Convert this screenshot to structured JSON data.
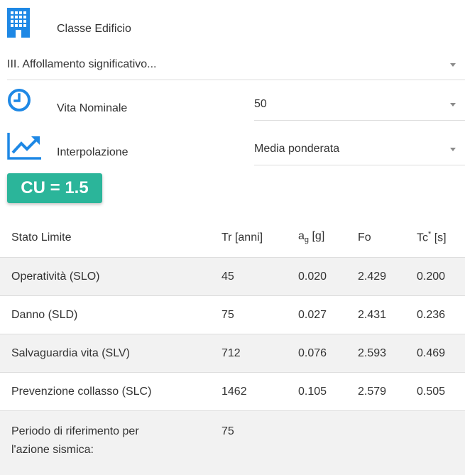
{
  "building_class": {
    "label": "Classe Edificio",
    "icon": "building-icon",
    "selected": "III. Affollamento significativo..."
  },
  "nominal_life": {
    "label": "Vita Nominale",
    "icon": "clock-icon",
    "selected": "50"
  },
  "interpolation": {
    "label": "Interpolazione",
    "icon": "trending-up-icon",
    "selected": "Media ponderata"
  },
  "cu_badge": "CU = 1.5",
  "colors": {
    "accent": "#2bb59a",
    "icon_blue": "#1e88e5"
  },
  "table": {
    "headers": {
      "state": "Stato Limite",
      "tr": "Tr [anni]",
      "ag_main": "a",
      "ag_sub": "g",
      "ag_unit": " [g]",
      "fo": "Fo",
      "tc_main": "Tc",
      "tc_sup": "*",
      "tc_unit": " [s]"
    },
    "rows": [
      {
        "state": "Operatività (SLO)",
        "tr": "45",
        "ag": "0.020",
        "fo": "2.429",
        "tc": "0.200"
      },
      {
        "state": "Danno (SLD)",
        "tr": "75",
        "ag": "0.027",
        "fo": "2.431",
        "tc": "0.236"
      },
      {
        "state": "Salvaguardia vita (SLV)",
        "tr": "712",
        "ag": "0.076",
        "fo": "2.593",
        "tc": "0.469"
      },
      {
        "state": "Prevenzione collasso (SLC)",
        "tr": "1462",
        "ag": "0.105",
        "fo": "2.579",
        "tc": "0.505"
      }
    ],
    "reference": {
      "label": "Periodo di riferimento per l'azione sismica:",
      "value": "75"
    }
  }
}
